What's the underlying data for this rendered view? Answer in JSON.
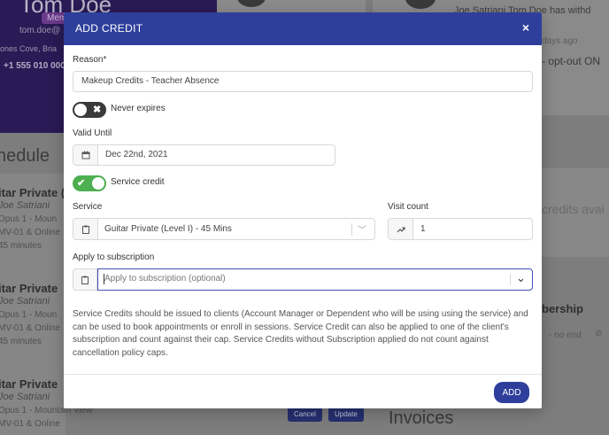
{
  "background": {
    "profile": {
      "name": "Tom Doe",
      "badge": "Mem",
      "email": "tom.doe@",
      "address": "ones Cove, Bria",
      "phone": "+1 555 010 000"
    },
    "activity": {
      "text": "Joe Satriani  Tom Doe has withd",
      "ago": "days ago",
      "optout": "- opt-out ON"
    },
    "schedule_heading": "nedule",
    "lessons": [
      {
        "title": "itar Private (",
        "teacher": "Joe Satriani",
        "room": "Opus 1 - Moun",
        "mode": "MV-01 & Online",
        "duration": "45 minutes"
      },
      {
        "title": "itar Private",
        "teacher": "Joe Satriani",
        "room": "Opus 1 - Moun",
        "mode": "MV-01 & Online",
        "duration": "45 minutes"
      },
      {
        "title": "itar Private",
        "teacher": "Joe Satriani",
        "room": "Opus 1 - Mountain View",
        "mode": "MV-01 & Online",
        "duration": ""
      }
    ],
    "credits_text": "credits avai",
    "membership_text": "bership",
    "no_end_text": "- no end",
    "invoices_heading": "Invoices",
    "cancel_label": "Cancel",
    "update_label": "Update"
  },
  "modal": {
    "title": "ADD CREDIT",
    "close_icon": "×",
    "reason": {
      "label": "Reason*",
      "value": "Makeup Credits - Teacher Absence"
    },
    "never_expires": {
      "label": "Never expires",
      "on": false
    },
    "valid_until": {
      "label": "Valid Until",
      "value": "Dec 22nd, 2021"
    },
    "service_credit": {
      "label": "Service credit",
      "on": true
    },
    "service": {
      "label": "Service",
      "value": "Guitar Private (Level I) - 45 Mins"
    },
    "visit_count": {
      "label": "Visit count",
      "value": "1"
    },
    "subscription": {
      "label": "Apply to subscription",
      "placeholder": "Apply to subscription (optional)"
    },
    "help_text": "Service Credits should be issued to clients (Account Manager or Dependent who will be using using the service) and can be used to book appointments or enroll in sessions. Service Credit can also be applied to one of the client's subscription and count against their cap. Service Credits without Subscription applied do not count against cancellation policy caps.",
    "add_label": "ADD"
  },
  "colors": {
    "header": "#2e3f9b",
    "toggle_on": "#4caf50",
    "toggle_off": "#3a3a3a",
    "focus_border": "#3f51b5"
  }
}
